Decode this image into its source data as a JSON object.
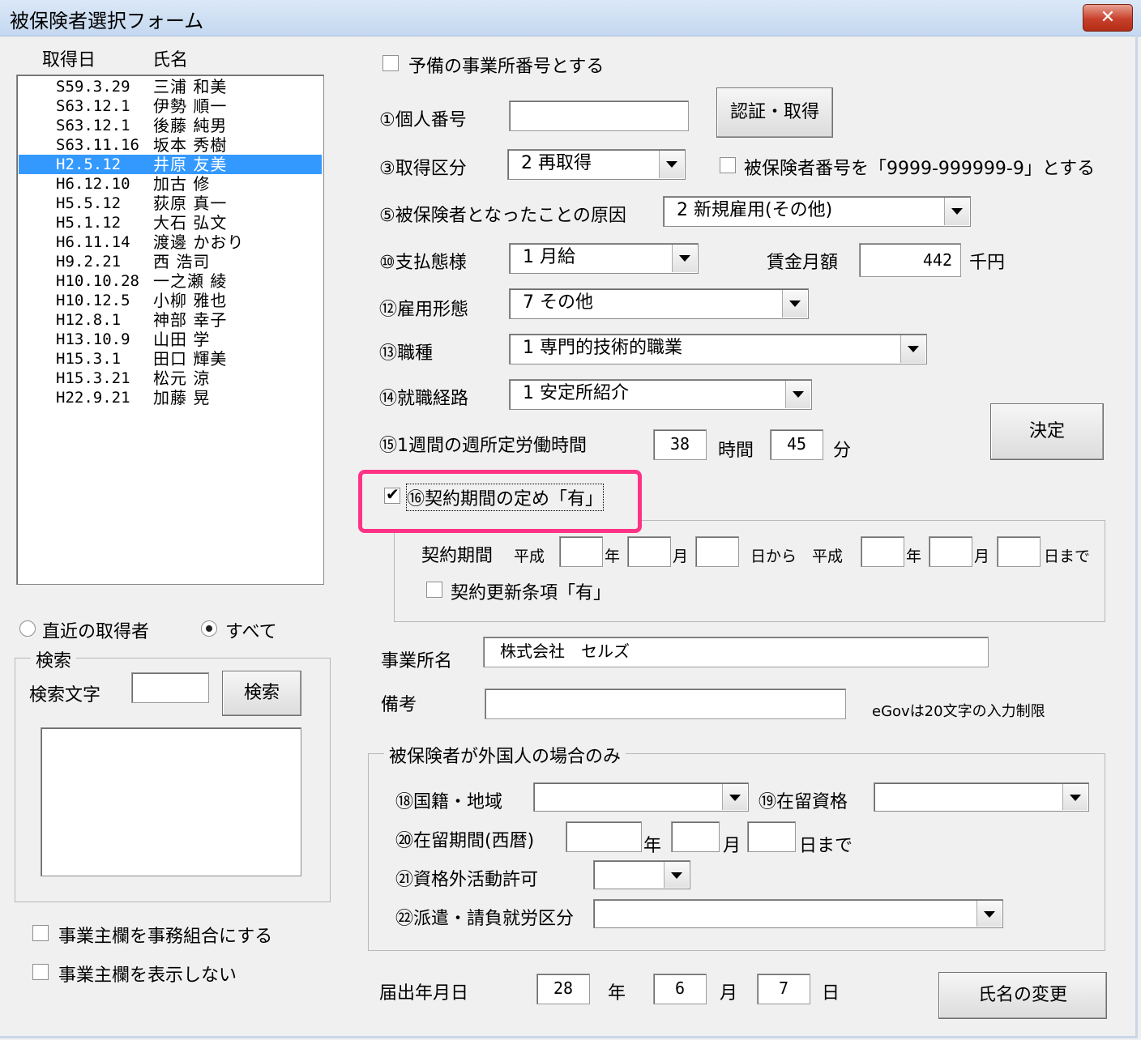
{
  "window": {
    "title": "被保険者選択フォーム",
    "close_label": "✕"
  },
  "list": {
    "headers": {
      "date": "取得日",
      "name": "氏名"
    },
    "rows": [
      {
        "date": "S59.3.29",
        "name": "三浦 和美"
      },
      {
        "date": "S63.12.1",
        "name": "伊勢 順一"
      },
      {
        "date": "S63.12.1",
        "name": "後藤 純男"
      },
      {
        "date": "S63.11.16",
        "name": "坂本 秀樹"
      },
      {
        "date": "H2.5.12",
        "name": "井原 友美"
      },
      {
        "date": "H6.12.10",
        "name": "加古 修"
      },
      {
        "date": "H5.5.12",
        "name": "荻原 真一"
      },
      {
        "date": "H5.1.12",
        "name": "大石 弘文"
      },
      {
        "date": "H6.11.14",
        "name": "渡邊 かおり"
      },
      {
        "date": "H9.2.21",
        "name": "西 浩司"
      },
      {
        "date": "H10.10.28",
        "name": "一之瀬 綾"
      },
      {
        "date": "H10.12.5",
        "name": "小柳 雅也"
      },
      {
        "date": "H12.8.1",
        "name": "神部 幸子"
      },
      {
        "date": "H13.10.9",
        "name": "山田 学"
      },
      {
        "date": "H15.3.1",
        "name": "田口 輝美"
      },
      {
        "date": "H15.3.21",
        "name": "松元 涼"
      },
      {
        "date": "H22.9.21",
        "name": "加藤 晃"
      }
    ],
    "selected_index": 4
  },
  "filter": {
    "recent_label": "直近の取得者",
    "all_label": "すべて",
    "selected": "all"
  },
  "search": {
    "group_label": "検索",
    "text_label": "検索文字",
    "text_value": "",
    "button_label": "検索"
  },
  "left_options": {
    "union_label": "事業主欄を事務組合にする",
    "hide_label": "事業主欄を表示しない"
  },
  "form": {
    "spare_office_label": "予備の事業所番号とする",
    "personal_number_label": "①個人番号",
    "personal_number_value": "",
    "auth_button_label": "認証・取得",
    "acquisition_type_label": "③取得区分",
    "acquisition_type_value": "2 再取得",
    "insured_number_check_label": "被保険者番号を「9999-999999-9」とする",
    "cause_label": "⑤被保険者となったことの原因",
    "cause_value": "2  新規雇用(その他)",
    "payment_label": "⑩支払態様",
    "payment_value": "1  月給",
    "wage_label": "賃金月額",
    "wage_value": "442",
    "wage_unit": "千円",
    "employment_label": "⑫雇用形態",
    "employment_value": "7  その他",
    "occupation_label": "⑬職種",
    "occupation_value": "1  専門的技術的職業",
    "route_label": "⑭就職経路",
    "route_value": "1  安定所紹介",
    "hours_label": "⑮1週間の週所定労働時間",
    "hours_value": "38",
    "hours_unit": "時間",
    "minutes_value": "45",
    "minutes_unit": "分",
    "decide_button_label": "決定",
    "contract_check_label": "⑯契約期間の定め「有」",
    "contract_checked": true,
    "contract": {
      "period_label": "契約期間",
      "era1": "平成",
      "year_unit": "年",
      "month_unit": "月",
      "from_label": "日から",
      "era2": "平成",
      "until_label": "日まで",
      "renewal_label": "契約更新条項「有」"
    },
    "office_name_label": "事業所名",
    "office_name_value": "株式会社　セルズ",
    "remarks_label": "備考",
    "remarks_value": "",
    "egov_note": "eGovは20文字の入力制限"
  },
  "foreign": {
    "group_label": "被保険者が外国人の場合のみ",
    "nationality_label": "⑱国籍・地域",
    "status_label": "⑲在留資格",
    "period_label": "⑳在留期間(西暦)",
    "year_unit": "年",
    "month_unit": "月",
    "until_label": "日まで",
    "activity_label": "㉑資格外活動許可",
    "dispatch_label": "㉒派遣・請負就労区分"
  },
  "filing": {
    "label": "届出年月日",
    "year": "28",
    "year_unit": "年",
    "month": "6",
    "month_unit": "月",
    "day": "7",
    "day_unit": "日",
    "rename_button_label": "氏名の変更"
  },
  "colors": {
    "selection": "#3399ff",
    "highlight": "#ff3385"
  }
}
